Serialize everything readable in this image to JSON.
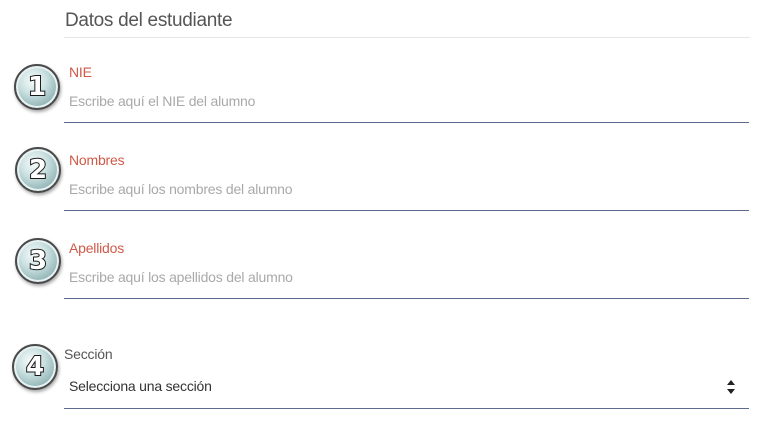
{
  "section": {
    "title": "Datos del estudiante"
  },
  "steps": [
    {
      "number": "1"
    },
    {
      "number": "2"
    },
    {
      "number": "3"
    },
    {
      "number": "4"
    }
  ],
  "fields": {
    "nie": {
      "label": "NIE",
      "placeholder": "Escribe aquí el NIE del alumno",
      "value": ""
    },
    "nombres": {
      "label": "Nombres",
      "placeholder": "Escribe aquí los nombres del alumno",
      "value": ""
    },
    "apellidos": {
      "label": "Apellidos",
      "placeholder": "Escribe aquí los apellidos del alumno",
      "value": ""
    },
    "seccion": {
      "label": "Sección",
      "selected": "Selecciona una sección",
      "icon": "select-arrows-icon"
    }
  },
  "colors": {
    "label_accent": "#cf5a48",
    "underline": "#5d6b8f",
    "placeholder": "#a9a9a9"
  }
}
